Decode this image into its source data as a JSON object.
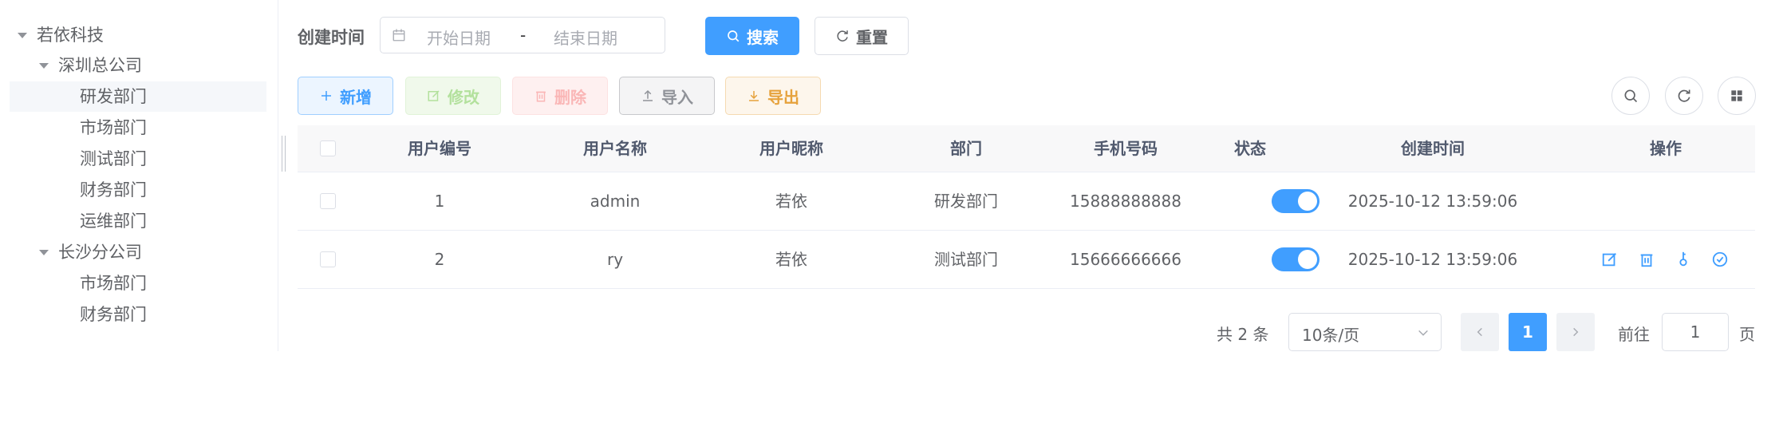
{
  "tree": {
    "nodes": [
      {
        "label": "若依科技"
      },
      {
        "label": "深圳总公司"
      },
      {
        "label": "研发部门"
      },
      {
        "label": "市场部门"
      },
      {
        "label": "测试部门"
      },
      {
        "label": "财务部门"
      },
      {
        "label": "运维部门"
      },
      {
        "label": "长沙分公司"
      },
      {
        "label": "市场部门"
      },
      {
        "label": "财务部门"
      }
    ],
    "selected": "研发部门"
  },
  "search": {
    "created_label": "创建时间",
    "start_placeholder": "开始日期",
    "separator": "-",
    "end_placeholder": "结束日期",
    "search_label": "搜索",
    "reset_label": "重置"
  },
  "toolbar": {
    "add_label": "新增",
    "edit_label": "修改",
    "delete_label": "删除",
    "import_label": "导入",
    "export_label": "导出",
    "right_icons": [
      "search-icon",
      "refresh-icon",
      "grid-icon"
    ]
  },
  "table": {
    "headers": [
      "用户编号",
      "用户名称",
      "用户昵称",
      "部门",
      "手机号码",
      "状态",
      "创建时间",
      "操作"
    ],
    "rows": [
      {
        "id": "1",
        "username": "admin",
        "nickname": "若依",
        "dept": "研发部门",
        "phone": "15888888888",
        "status_on": true,
        "created": "2025-10-12 13:59:06",
        "actions": []
      },
      {
        "id": "2",
        "username": "ry",
        "nickname": "若依",
        "dept": "测试部门",
        "phone": "15666666666",
        "status_on": true,
        "created": "2025-10-12 13:59:06",
        "actions": [
          "edit-icon",
          "delete-icon",
          "key-icon",
          "check-circle-icon"
        ]
      }
    ]
  },
  "pagination": {
    "total_text": "共 2 条",
    "page_size": "10条/页",
    "current_page": "1",
    "goto_label": "前往",
    "goto_value": "1",
    "page_suffix": "页"
  },
  "colors": {
    "primary": "#409eff",
    "text": "#606266",
    "border": "#dcdfe6",
    "header_bg": "#f8f8f9"
  }
}
